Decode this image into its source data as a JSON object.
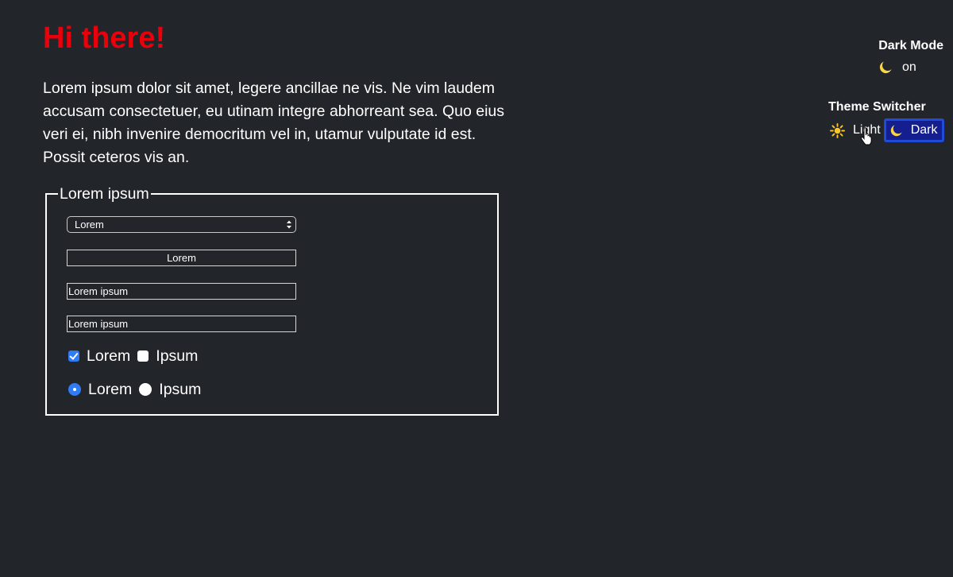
{
  "page": {
    "title": "Hi there!",
    "intro": "Lorem ipsum dolor sit amet, legere ancillae ne vis. Ne vim laudem accusam consectetuer, eu utinam integre abhorreant sea. Quo eius veri ei, nibh invenire democritum vel in, utamur vulputate id est. Possit ceteros vis an."
  },
  "form": {
    "legend": "Lorem ipsum",
    "select_value": "Lorem",
    "input_center_value": "Lorem",
    "input_1_value": "Lorem ipsum",
    "input_2_value": "Lorem ipsum",
    "checkboxes": [
      {
        "label": "Lorem",
        "checked": true
      },
      {
        "label": "Ipsum",
        "checked": false
      }
    ],
    "radios": [
      {
        "label": "Lorem",
        "selected": true
      },
      {
        "label": "Ipsum",
        "selected": false
      }
    ]
  },
  "dark_mode": {
    "title": "Dark Mode",
    "status": "on",
    "icon": "moon-icon"
  },
  "theme_switcher": {
    "title": "Theme Switcher",
    "light_label": "Light",
    "light_icon": "sun-icon",
    "dark_label": "Dark",
    "dark_icon": "moon-icon",
    "selected": "Dark"
  },
  "colors": {
    "background": "#22252a",
    "title": "#e8000b",
    "accent": "#2f7cf6",
    "selected_theme_bg": "#151e8e",
    "selected_theme_border": "#1f4bd6"
  }
}
